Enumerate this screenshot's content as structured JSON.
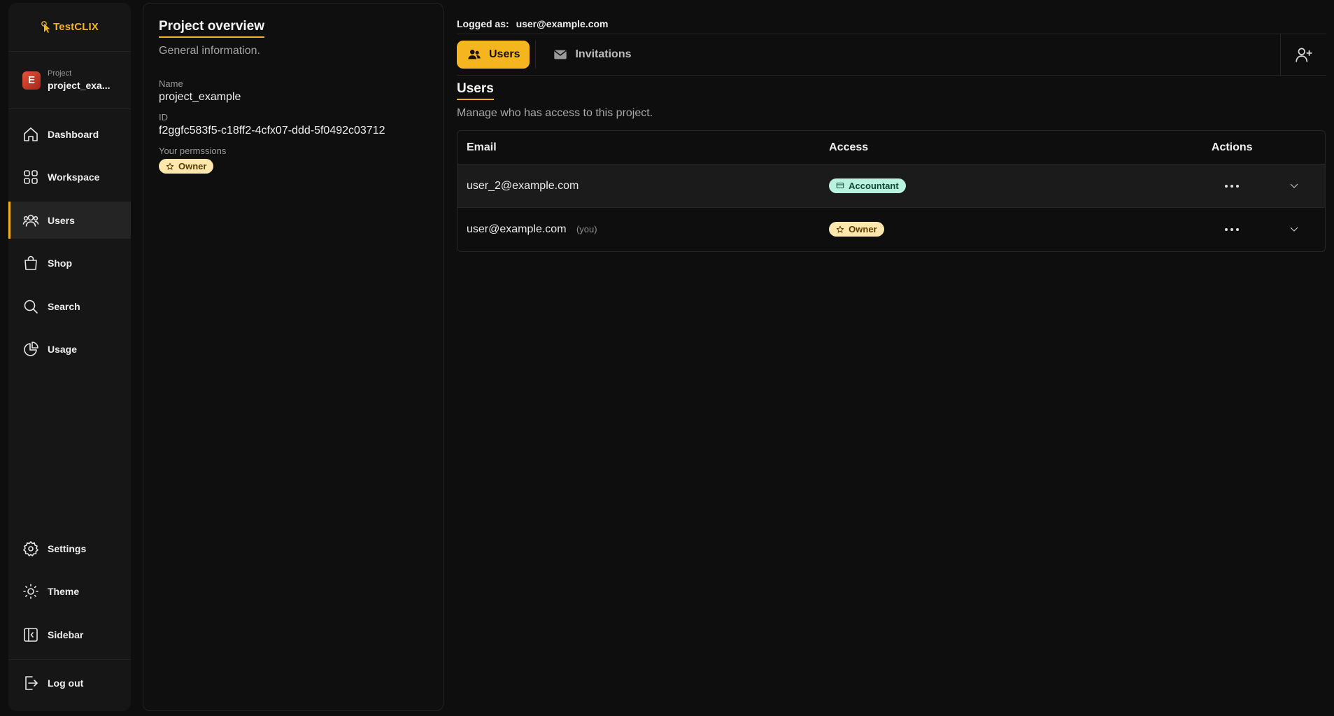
{
  "app": {
    "brand": "TestCLIX"
  },
  "colors": {
    "accent": "#f4b321",
    "owner_badge": "#fde7ad",
    "accountant_badge": "#b9f3df"
  },
  "sidebar": {
    "project": {
      "avatar_letter": "E",
      "label": "Project",
      "name": "project_exa..."
    },
    "items": [
      {
        "label": "Dashboard",
        "icon": "home-icon"
      },
      {
        "label": "Workspace",
        "icon": "grid-icon"
      },
      {
        "label": "Users",
        "icon": "users-icon",
        "active": true
      },
      {
        "label": "Shop",
        "icon": "shopping-bag-icon"
      },
      {
        "label": "Search",
        "icon": "search-icon"
      },
      {
        "label": "Usage",
        "icon": "pie-chart-icon"
      }
    ],
    "bottom_items": [
      {
        "label": "Settings",
        "icon": "gear-icon"
      },
      {
        "label": "Theme",
        "icon": "sun-icon"
      },
      {
        "label": "Sidebar",
        "icon": "sidebar-icon"
      }
    ],
    "logout": {
      "label": "Log out",
      "icon": "logout-icon"
    }
  },
  "overview": {
    "title": "Project overview",
    "subtitle": "General information.",
    "name_label": "Name",
    "name_value": "project_example",
    "id_label": "ID",
    "id_value": "f2ggfc583f5-c18ff2-4cfx07-ddd-5f0492c03712",
    "permissions_label": "Your permssions",
    "permission_badge": "Owner"
  },
  "header": {
    "logged_label": "Logged as:",
    "logged_email": "user@example.com"
  },
  "tabs": [
    {
      "label": "Users",
      "icon": "users-icon",
      "active": true
    },
    {
      "label": "Invitations",
      "icon": "envelope-icon",
      "active": false
    }
  ],
  "users_section": {
    "title": "Users",
    "subtitle": "Manage who has access to this project.",
    "columns": [
      "Email",
      "Access",
      "Actions"
    ],
    "rows": [
      {
        "email": "user_2@example.com",
        "you_tag": "",
        "access": "Accountant"
      },
      {
        "email": "user@example.com",
        "you_tag": "(you)",
        "access": "Owner"
      }
    ]
  }
}
